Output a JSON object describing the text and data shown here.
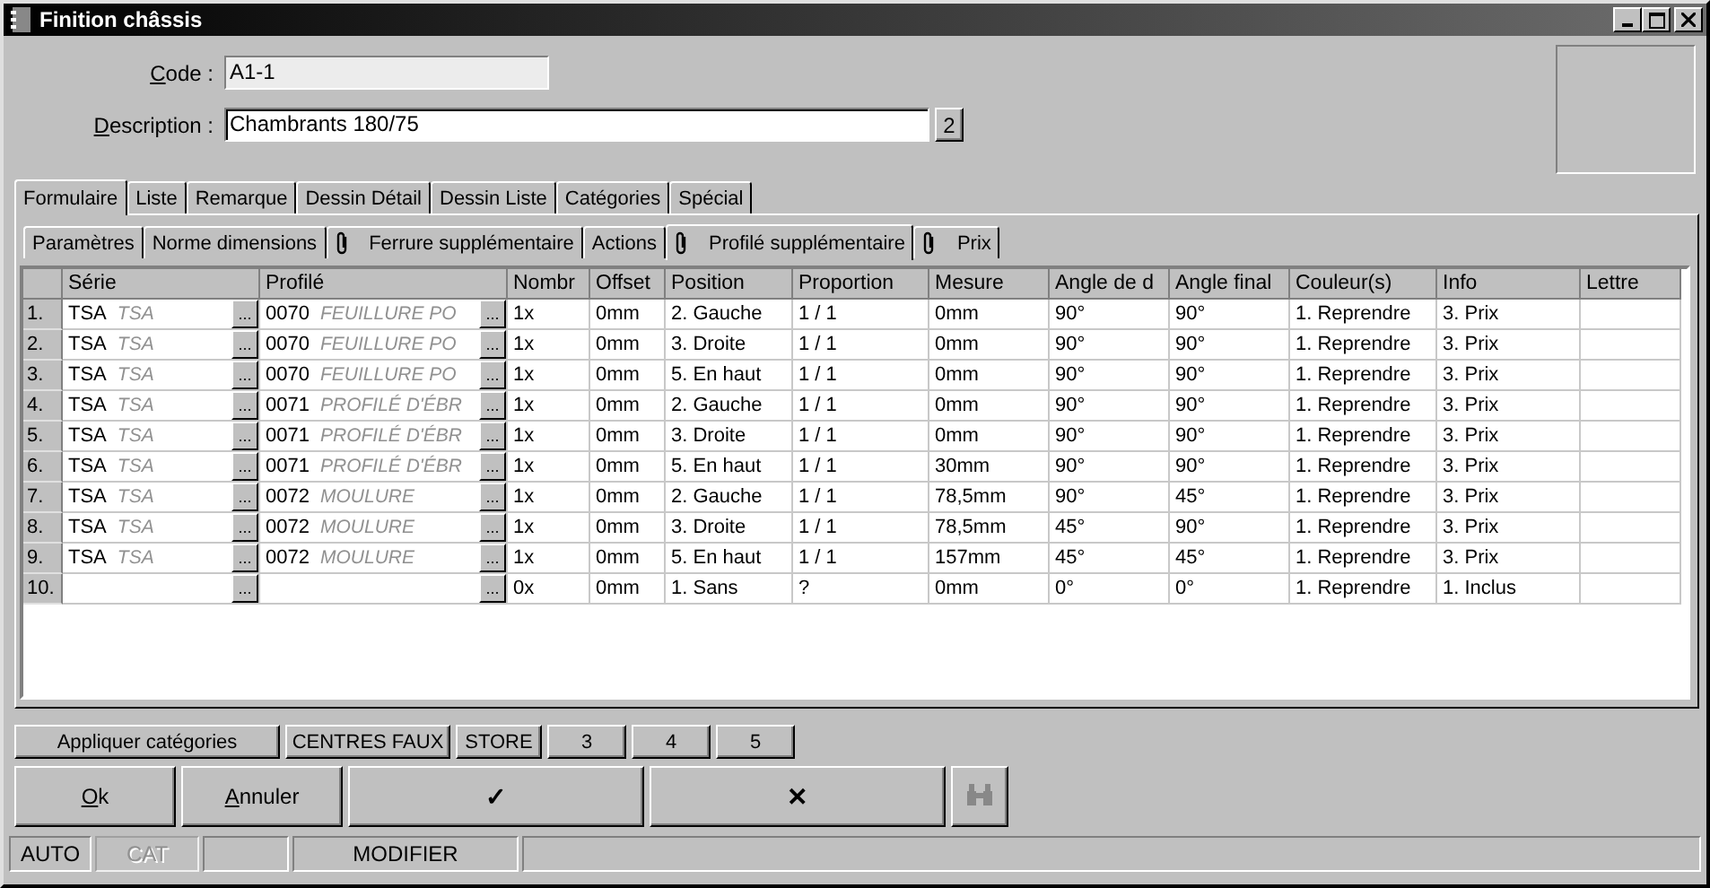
{
  "window": {
    "title": "Finition châssis"
  },
  "form": {
    "code_label": "Code :",
    "code_value": "A1-1",
    "description_label": "Description :",
    "description_value": "Chambrants 180/75",
    "description_button": "2"
  },
  "tabs": [
    {
      "label": "Formulaire",
      "selected": true
    },
    {
      "label": "Liste",
      "selected": false
    },
    {
      "label": "Remarque",
      "selected": false
    },
    {
      "label": "Dessin Détail",
      "selected": false
    },
    {
      "label": "Dessin Liste",
      "selected": false
    },
    {
      "label": "Catégories",
      "selected": false
    },
    {
      "label": "Spécial",
      "selected": false
    }
  ],
  "subtabs": [
    {
      "label": "Paramètres",
      "selected": false,
      "clip": false
    },
    {
      "label": "Norme dimensions",
      "selected": false,
      "clip": false
    },
    {
      "label": "Ferrure supplémentaire",
      "selected": false,
      "clip": true
    },
    {
      "label": "Actions",
      "selected": false,
      "clip": false
    },
    {
      "label": "Profilé supplémentaire",
      "selected": true,
      "clip": true
    },
    {
      "label": "Prix",
      "selected": false,
      "clip": true
    }
  ],
  "table": {
    "columns": [
      "Série",
      "Profilé",
      "Nombr",
      "Offset",
      "Position",
      "Proportion",
      "Mesure",
      "Angle de d",
      "Angle final",
      "Couleur(s)",
      "Info",
      "Lettre"
    ],
    "rows": [
      {
        "num": "1.",
        "serie": "TSA",
        "serie_name": "TSA",
        "profile": "0070",
        "profile_name": "FEUILLURE PO",
        "nombre": "1x",
        "offset": "0mm",
        "position": "2. Gauche",
        "proportion": "1 / 1",
        "mesure": "0mm",
        "angle_start": "90°",
        "angle_end": "90°",
        "couleur": "1. Reprendre",
        "info": "3. Prix"
      },
      {
        "num": "2.",
        "serie": "TSA",
        "serie_name": "TSA",
        "profile": "0070",
        "profile_name": "FEUILLURE PO",
        "nombre": "1x",
        "offset": "0mm",
        "position": "3. Droite",
        "proportion": "1 / 1",
        "mesure": "0mm",
        "angle_start": "90°",
        "angle_end": "90°",
        "couleur": "1. Reprendre",
        "info": "3. Prix"
      },
      {
        "num": "3.",
        "serie": "TSA",
        "serie_name": "TSA",
        "profile": "0070",
        "profile_name": "FEUILLURE PO",
        "nombre": "1x",
        "offset": "0mm",
        "position": "5. En haut",
        "proportion": "1 / 1",
        "mesure": "0mm",
        "angle_start": "90°",
        "angle_end": "90°",
        "couleur": "1. Reprendre",
        "info": "3. Prix"
      },
      {
        "num": "4.",
        "serie": "TSA",
        "serie_name": "TSA",
        "profile": "0071",
        "profile_name": "PROFILÉ D'ÉBR",
        "nombre": "1x",
        "offset": "0mm",
        "position": "2. Gauche",
        "proportion": "1 / 1",
        "mesure": "0mm",
        "angle_start": "90°",
        "angle_end": "90°",
        "couleur": "1. Reprendre",
        "info": "3. Prix"
      },
      {
        "num": "5.",
        "serie": "TSA",
        "serie_name": "TSA",
        "profile": "0071",
        "profile_name": "PROFILÉ D'ÉBR",
        "nombre": "1x",
        "offset": "0mm",
        "position": "3. Droite",
        "proportion": "1 / 1",
        "mesure": "0mm",
        "angle_start": "90°",
        "angle_end": "90°",
        "couleur": "1. Reprendre",
        "info": "3. Prix"
      },
      {
        "num": "6.",
        "serie": "TSA",
        "serie_name": "TSA",
        "profile": "0071",
        "profile_name": "PROFILÉ D'ÉBR",
        "nombre": "1x",
        "offset": "0mm",
        "position": "5. En haut",
        "proportion": "1 / 1",
        "mesure": "30mm",
        "angle_start": "90°",
        "angle_end": "90°",
        "couleur": "1. Reprendre",
        "info": "3. Prix"
      },
      {
        "num": "7.",
        "serie": "TSA",
        "serie_name": "TSA",
        "profile": "0072",
        "profile_name": "MOULURE",
        "nombre": "1x",
        "offset": "0mm",
        "position": "2. Gauche",
        "proportion": "1 / 1",
        "mesure": "78,5mm",
        "angle_start": "90°",
        "angle_end": "45°",
        "couleur": "1. Reprendre",
        "info": "3. Prix"
      },
      {
        "num": "8.",
        "serie": "TSA",
        "serie_name": "TSA",
        "profile": "0072",
        "profile_name": "MOULURE",
        "nombre": "1x",
        "offset": "0mm",
        "position": "3. Droite",
        "proportion": "1 / 1",
        "mesure": "78,5mm",
        "angle_start": "45°",
        "angle_end": "90°",
        "couleur": "1. Reprendre",
        "info": "3. Prix"
      },
      {
        "num": "9.",
        "serie": "TSA",
        "serie_name": "TSA",
        "profile": "0072",
        "profile_name": "MOULURE",
        "nombre": "1x",
        "offset": "0mm",
        "position": "5. En haut",
        "proportion": "1 / 1",
        "mesure": "157mm",
        "angle_start": "45°",
        "angle_end": "45°",
        "couleur": "1. Reprendre",
        "info": "3. Prix"
      },
      {
        "num": "10.",
        "nombre": "0x",
        "offset": "0mm",
        "position": "1. Sans",
        "proportion": "?",
        "mesure": "0mm",
        "angle_start": "0°",
        "angle_end": "0°",
        "couleur": "1. Reprendre",
        "info": "1. Inclus"
      }
    ],
    "picker_button": "..."
  },
  "small_buttons": [
    "Appliquer catégories",
    "CENTRES FAUX",
    "STORE",
    "3",
    "4",
    "5"
  ],
  "action_buttons": [
    {
      "kind": "text",
      "label": "Ok"
    },
    {
      "kind": "text",
      "label": "Annuler"
    },
    {
      "kind": "glyph",
      "label": "✓"
    },
    {
      "kind": "glyph",
      "label": "✕"
    },
    {
      "kind": "binoculars"
    }
  ],
  "status_bar": [
    {
      "label": "AUTO",
      "disabled": false
    },
    {
      "label": "CAT",
      "disabled": true
    },
    {
      "disabled": false
    },
    {
      "label": "MODIFIER",
      "disabled": false
    }
  ]
}
